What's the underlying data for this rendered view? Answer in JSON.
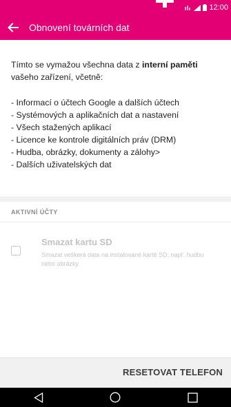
{
  "status_bar": {
    "time": "12:00",
    "icons": [
      "network-icon",
      "signal-icon",
      "battery-icon"
    ],
    "brand_color": "#e20074"
  },
  "app_bar": {
    "back_icon": "back-arrow-icon",
    "title": "Obnovení továrních dat"
  },
  "content": {
    "intro_prefix": "Tímto se vymažou všechna data z ",
    "intro_bold": "interní paměti",
    "intro_suffix": " vašeho zařízení, včetně:",
    "items": [
      "- Informací o účtech Google a dalších účtech",
      "- Systémových a aplikačních dat a nastavení",
      "- Všech stažených aplikací",
      "- Licence ke kontrole digitálních práv (DRM)",
      "- Hudba, obrázky, dokumenty a zálohy>",
      "- Dalších uživatelských dat"
    ]
  },
  "accounts_section": {
    "header": "AKTIVNÍ ÚČTY"
  },
  "sd_option": {
    "checked": false,
    "title": "Smazat kartu SD",
    "description": "Smazat veškerá data na instalované kartě SD, např. hudbu nebo obrázky"
  },
  "action": {
    "reset_label": "RESETOVAT TELEFON"
  },
  "nav_bar": {
    "icons": [
      "back-triangle-icon",
      "home-circle-icon",
      "recents-square-icon"
    ]
  }
}
